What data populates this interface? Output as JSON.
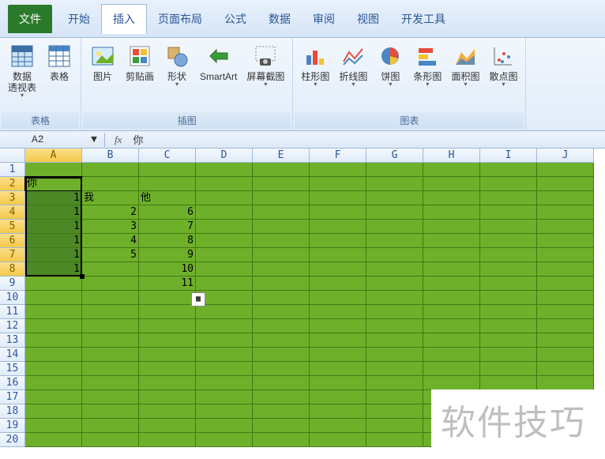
{
  "tabs": {
    "file": "文件",
    "home": "开始",
    "insert": "插入",
    "layout": "页面布局",
    "formula": "公式",
    "data": "数据",
    "review": "审阅",
    "view": "视图",
    "dev": "开发工具"
  },
  "ribbon": {
    "groups": {
      "tables": {
        "label": "表格",
        "pivot": "数据\n透视表",
        "table": "表格"
      },
      "illus": {
        "label": "插图",
        "pic": "图片",
        "clip": "剪贴画",
        "shape": "形状",
        "smartart": "SmartArt",
        "screenshot": "屏幕截图"
      },
      "charts": {
        "label": "图表",
        "column": "柱形图",
        "line": "折线图",
        "pie": "饼图",
        "bar": "条形图",
        "area": "面积图",
        "scatter": "散点图"
      }
    }
  },
  "formula_bar": {
    "name_box": "A2",
    "fx": "fx",
    "value": "你"
  },
  "sheet": {
    "columns": [
      "A",
      "B",
      "C",
      "D",
      "E",
      "F",
      "G",
      "H",
      "I",
      "J"
    ],
    "selected_col": "A",
    "rows": 20,
    "selected_rows": [
      2,
      3,
      4,
      5,
      6,
      7,
      8
    ],
    "active_cell": "A2",
    "cells": {
      "A2": {
        "v": "你",
        "t": "txt"
      },
      "A3": {
        "v": "1",
        "t": "num"
      },
      "A4": {
        "v": "1",
        "t": "num"
      },
      "A5": {
        "v": "1",
        "t": "num"
      },
      "A6": {
        "v": "1",
        "t": "num"
      },
      "A7": {
        "v": "1",
        "t": "num"
      },
      "A8": {
        "v": "1",
        "t": "num"
      },
      "B3": {
        "v": "我",
        "t": "txt"
      },
      "B4": {
        "v": "2",
        "t": "num"
      },
      "B5": {
        "v": "3",
        "t": "num"
      },
      "B6": {
        "v": "4",
        "t": "num"
      },
      "B7": {
        "v": "5",
        "t": "num"
      },
      "C3": {
        "v": "他",
        "t": "txt"
      },
      "C4": {
        "v": "6",
        "t": "num"
      },
      "C5": {
        "v": "7",
        "t": "num"
      },
      "C6": {
        "v": "8",
        "t": "num"
      },
      "C7": {
        "v": "9",
        "t": "num"
      },
      "C8": {
        "v": "10",
        "t": "num"
      },
      "C9": {
        "v": "11",
        "t": "num"
      }
    }
  },
  "watermark": "软件技巧"
}
